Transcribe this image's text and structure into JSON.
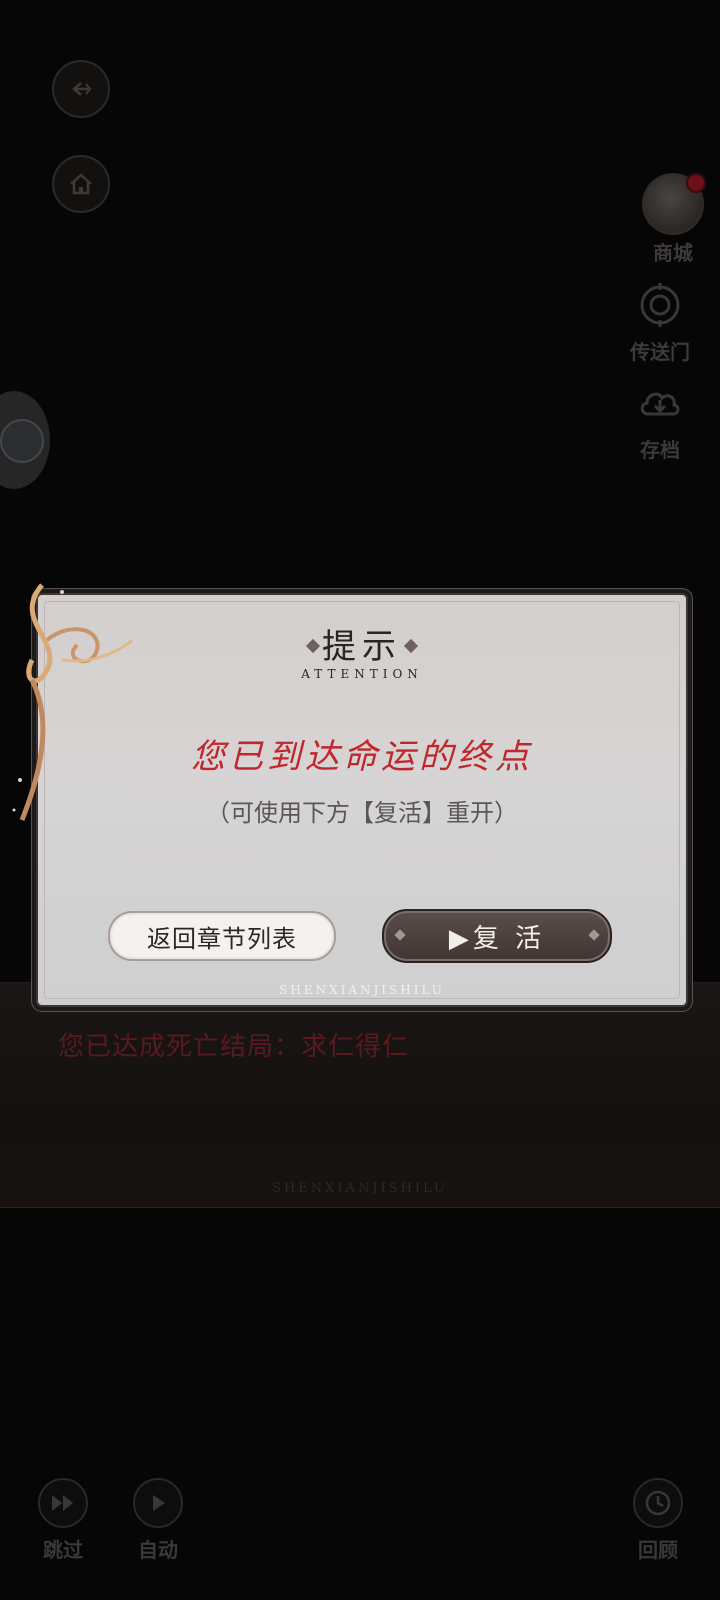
{
  "dialogue": {
    "text": "您已达成死亡结局：求仁得仁",
    "watermark": "SHENXIANJISHILU"
  },
  "side_menu": {
    "shop": "商城",
    "portal": "传送门",
    "save": "存档"
  },
  "bottom_controls": {
    "skip": "跳过",
    "auto": "自动",
    "review": "回顾"
  },
  "modal": {
    "title": "提示",
    "subtitle": "ATTENTION",
    "message": "您已到达命运的终点",
    "hint": "（可使用下方【复活】重开）",
    "back_button": "返回章节列表",
    "revive_button": "▶复 活",
    "watermark": "SHENXIANJISHILU"
  },
  "colors": {
    "message_red": "#c1262c",
    "panel_bg": "#d4cfcd",
    "revive_btn": "#4a3f3c"
  }
}
